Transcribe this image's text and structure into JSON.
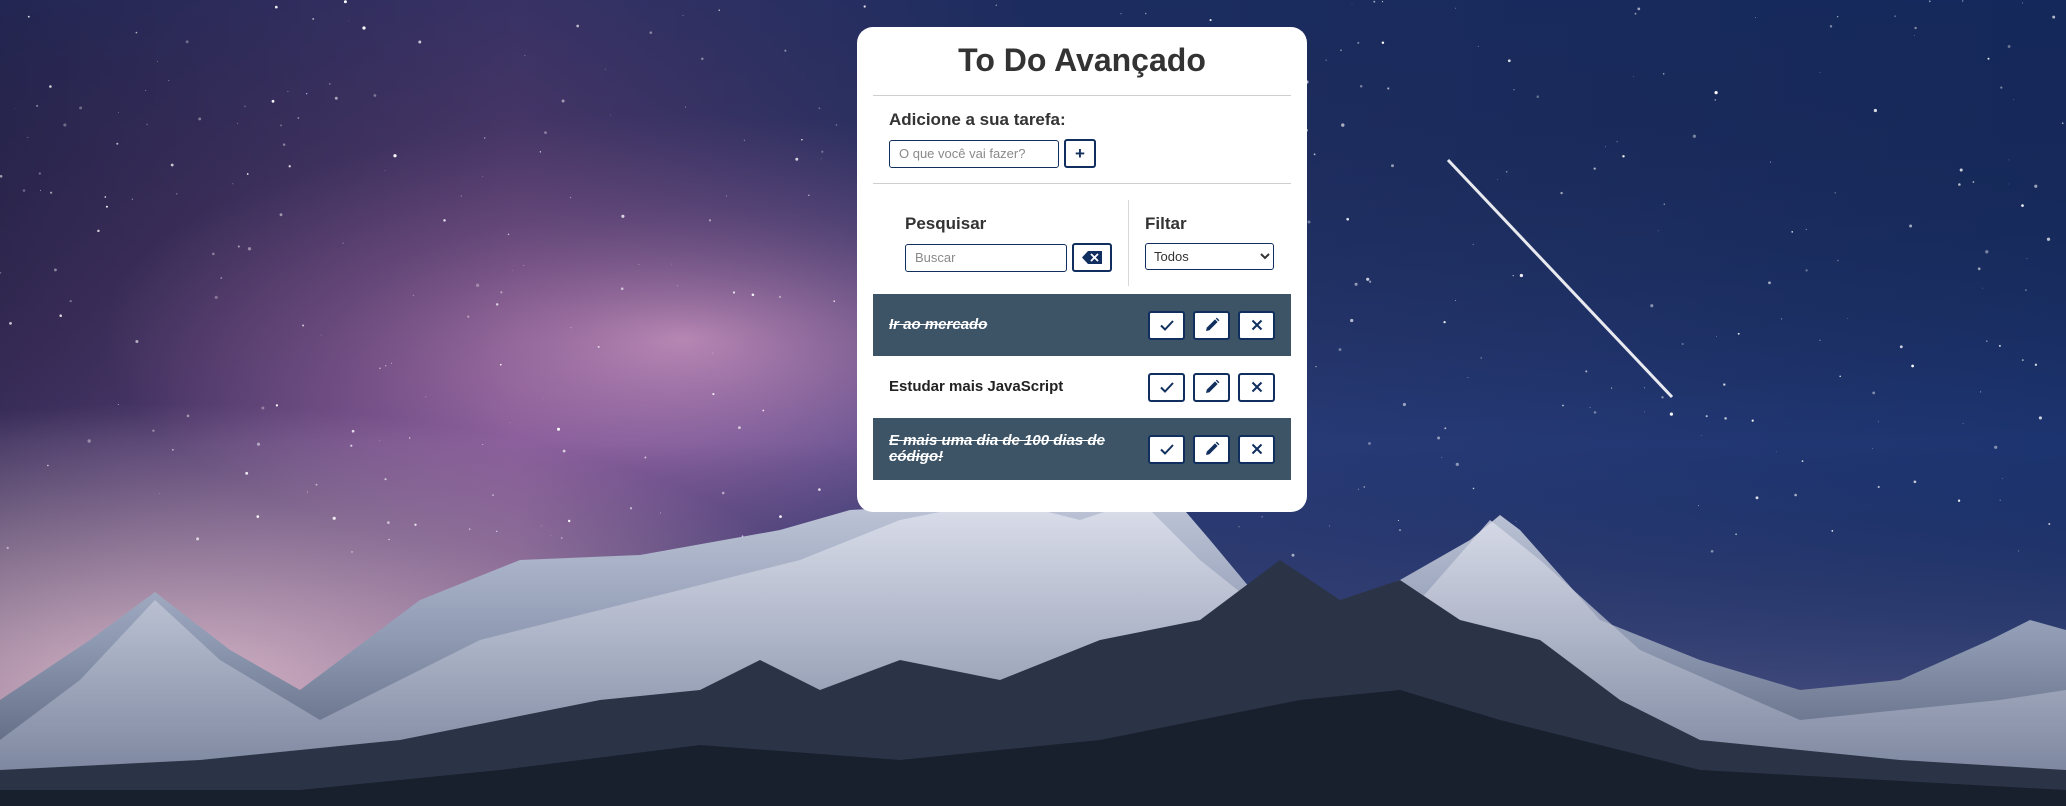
{
  "app": {
    "title": "To Do Avançado"
  },
  "add_task": {
    "label": "Adicione a sua tarefa:",
    "input_value": "",
    "input_placeholder": "O que você vai fazer?",
    "add_button_label": "+"
  },
  "search": {
    "label": "Pesquisar",
    "input_value": "",
    "input_placeholder": "Buscar",
    "clear_icon": "backspace-icon"
  },
  "filter": {
    "label": "Filtar",
    "selected": "Todos"
  },
  "todos": [
    {
      "text": "Ir ao mercado",
      "done": true
    },
    {
      "text": "Estudar mais JavaScript",
      "done": false
    },
    {
      "text": "E mais uma dia de 100 dias de código!",
      "done": true
    }
  ],
  "todo_action_icons": [
    "check-icon",
    "pencil-icon",
    "close-icon"
  ],
  "colors": {
    "accent": "#102f5e",
    "done_row_background": "#3d5467",
    "card_background": "#ffffff",
    "title_text": "#333333"
  }
}
